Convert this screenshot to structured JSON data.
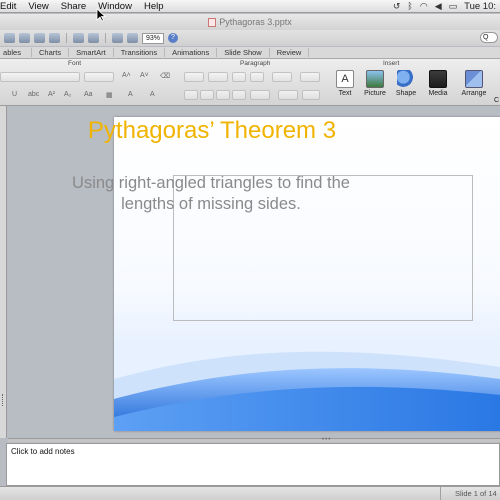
{
  "menubar": {
    "items": [
      "Edit",
      "View",
      "Share",
      "Window",
      "Help"
    ],
    "clock": "Tue 10:"
  },
  "window": {
    "title": "Pythagoras 3.pptx"
  },
  "toolbar": {
    "zoom": "93%",
    "help": "?",
    "search": "Q"
  },
  "ribbon": {
    "tabs": [
      "ables",
      "Charts",
      "SmartArt",
      "Transitions",
      "Animations",
      "Slide Show",
      "Review"
    ],
    "groups": {
      "font": "Font",
      "paragraph": "Paragraph",
      "insert": "Insert"
    },
    "insert_buttons": [
      "Text",
      "Picture",
      "Shape",
      "Media",
      "Arrange"
    ],
    "extra": "C"
  },
  "slide": {
    "title": "Pythagoras’ Theorem 3",
    "subtitle": "Using right-angled triangles to find the lengths of missing sides."
  },
  "notes": {
    "placeholder": "Click to add notes"
  },
  "status": {
    "slide_count": "Slide 1 of 14"
  },
  "colors": {
    "title_accent": "#f0b400",
    "subtitle_gray": "#8a8a8a",
    "wave_blue": "#2a78e4"
  }
}
